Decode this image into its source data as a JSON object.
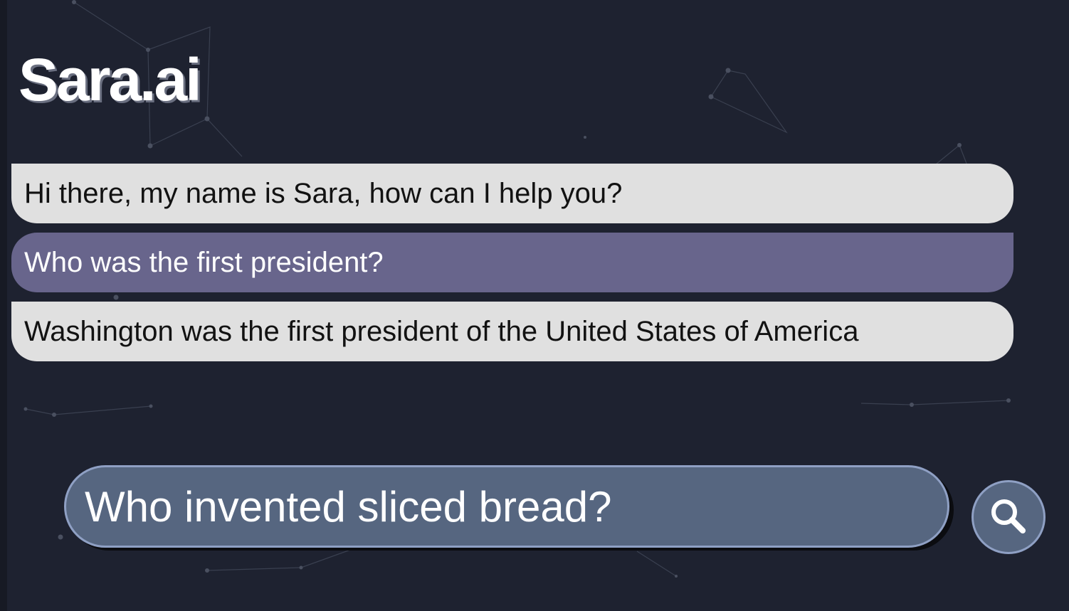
{
  "header": {
    "logo_text": "Sara.ai"
  },
  "chat": {
    "messages": [
      {
        "role": "bot",
        "text": "Hi there, my name is Sara, how can I help you?"
      },
      {
        "role": "user",
        "text": "Who was the first president?"
      },
      {
        "role": "bot",
        "text": "Washington was the first president of the United States of America"
      }
    ]
  },
  "composer": {
    "input_value": "Who invented sliced bread?",
    "search_icon": "search-icon"
  },
  "colors": {
    "background": "#1e2230",
    "bot_bubble": "#e0e0e0",
    "user_bubble": "#68658c",
    "input_fill": "#566680",
    "input_border": "#8fa0c4"
  }
}
